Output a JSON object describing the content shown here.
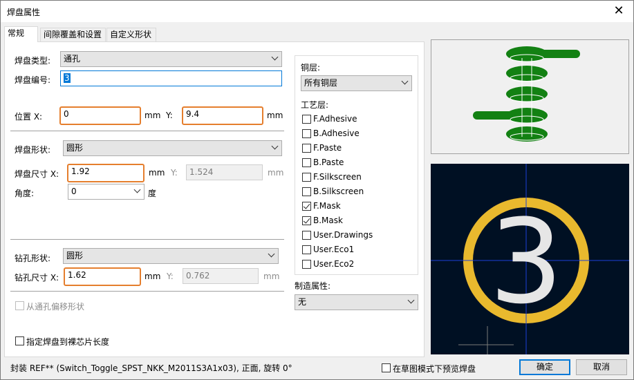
{
  "window": {
    "title": "焊盘属性",
    "close": "✕"
  },
  "tabs": [
    "常规",
    "间隙覆盖和设置",
    "自定义形状"
  ],
  "general": {
    "pad_type_label": "焊盘类型:",
    "pad_type_value": "通孔",
    "pad_number_label": "焊盘编号:",
    "pad_number_value": "3",
    "position_x_label": "位置 X:",
    "position_x_value": "0",
    "position_x_unit": "mm",
    "position_y_label": "Y:",
    "position_y_value": "9.4",
    "position_y_unit": "mm",
    "pad_shape_label": "焊盘形状:",
    "pad_shape_value": "圆形",
    "pad_size_x_label": "焊盘尺寸 X:",
    "pad_size_x_value": "1.92",
    "pad_size_x_unit": "mm",
    "pad_size_y_label": "Y:",
    "pad_size_y_value": "1.524",
    "pad_size_y_unit": "mm",
    "angle_label": "角度:",
    "angle_value": "0",
    "angle_unit": "度",
    "drill_shape_label": "钻孔形状:",
    "drill_shape_value": "圆形",
    "drill_size_x_label": "钻孔尺寸 X:",
    "drill_size_x_value": "1.62",
    "drill_size_x_unit": "mm",
    "drill_size_y_label": "Y:",
    "drill_size_y_value": "0.762",
    "drill_size_y_unit": "mm",
    "offset_label": "从通孔偏移形状",
    "die_length_label": "指定焊盘到裸芯片长度"
  },
  "layers": {
    "copper_label": "铜层:",
    "copper_value": "所有铜层",
    "tech_label": "工艺层:",
    "items": [
      {
        "name": "F.Adhesive",
        "checked": false
      },
      {
        "name": "B.Adhesive",
        "checked": false
      },
      {
        "name": "F.Paste",
        "checked": false
      },
      {
        "name": "B.Paste",
        "checked": false
      },
      {
        "name": "F.Silkscreen",
        "checked": false
      },
      {
        "name": "B.Silkscreen",
        "checked": false
      },
      {
        "name": "F.Mask",
        "checked": true
      },
      {
        "name": "B.Mask",
        "checked": true
      },
      {
        "name": "User.Drawings",
        "checked": false
      },
      {
        "name": "User.Eco1",
        "checked": false
      },
      {
        "name": "User.Eco2",
        "checked": false
      }
    ],
    "fab_label": "制造属性:",
    "fab_value": "无"
  },
  "preview": {
    "pad_number": "3",
    "colors": {
      "pad": "#138113",
      "ring": "#e9b92e",
      "bg": "#001023",
      "axis": "#1b3fd8"
    }
  },
  "footer": {
    "status": "封装 REF** (Switch_Toggle_SPST_NKK_M2011S3A1x03), 正面, 旋转 0°",
    "sketch_label": "在草图模式下预览焊盘",
    "ok": "确定",
    "cancel": "取消"
  }
}
